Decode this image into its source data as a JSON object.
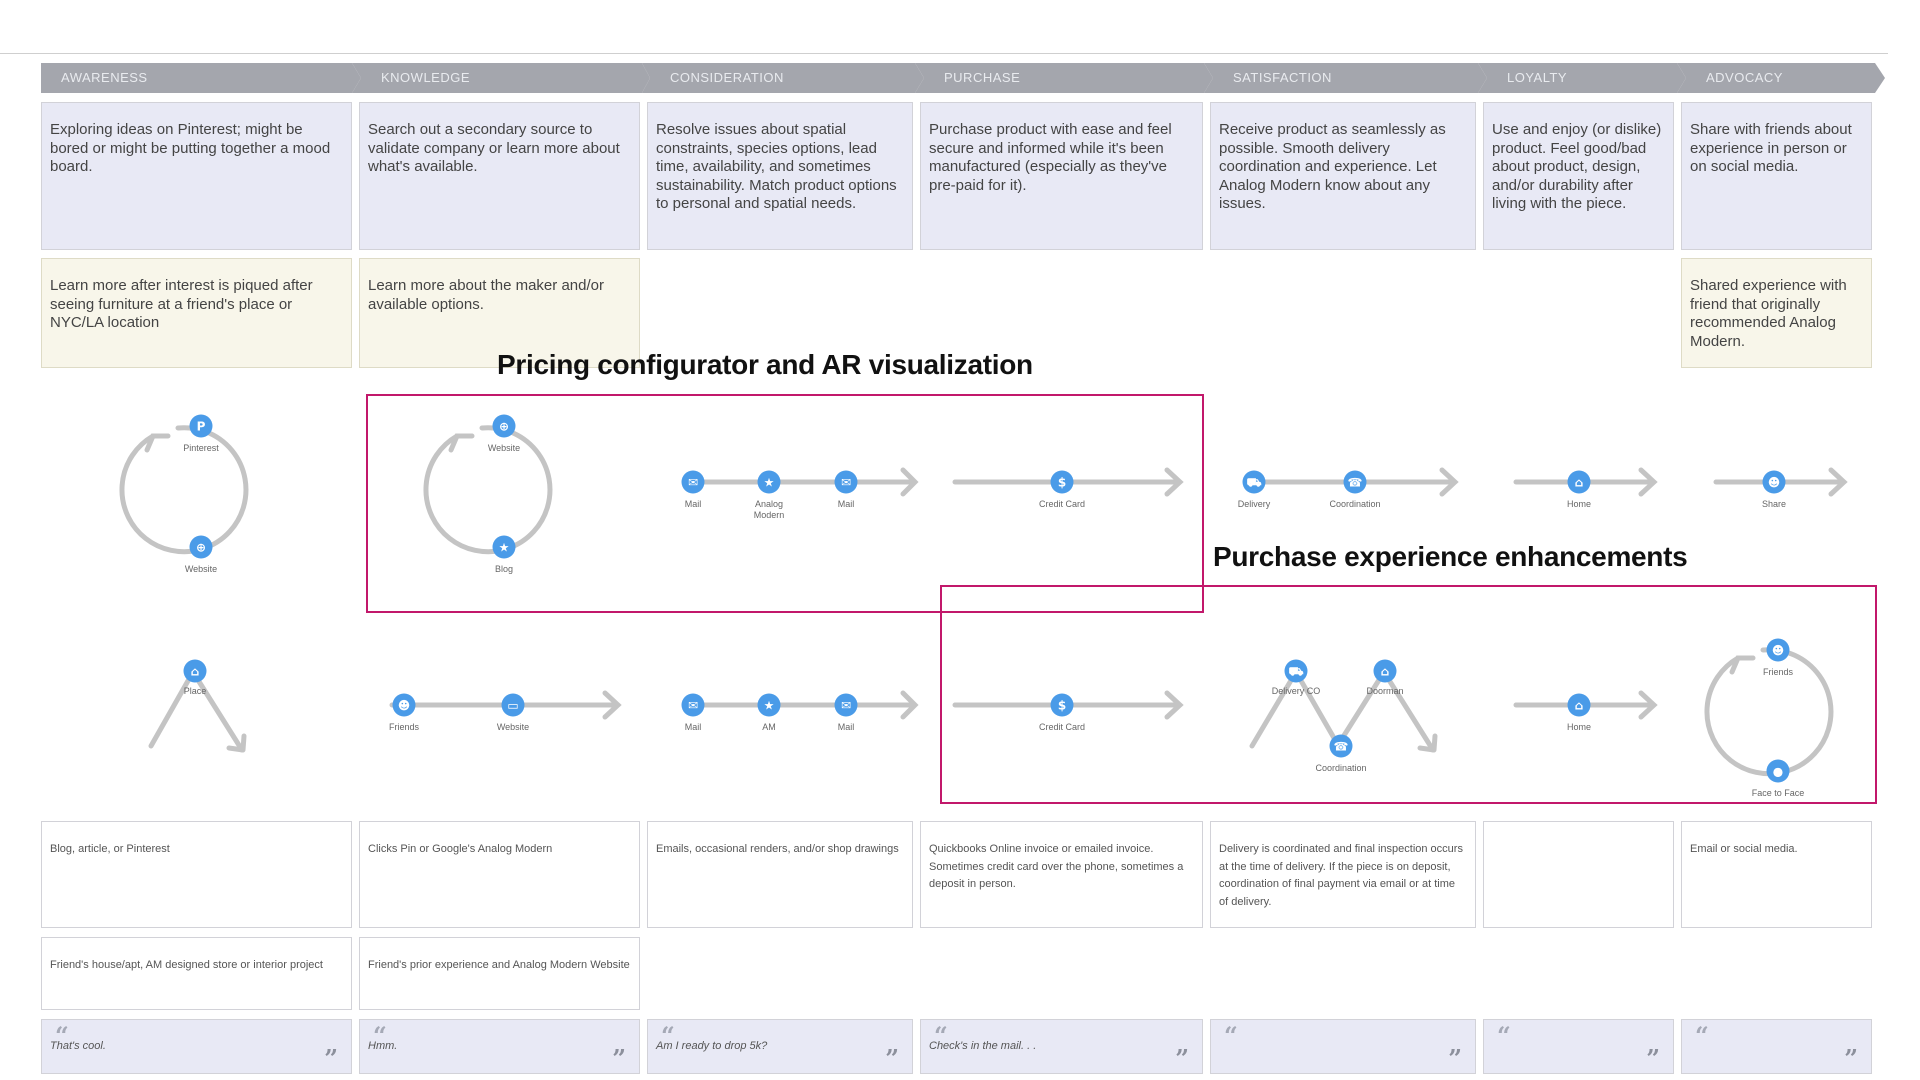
{
  "stages": [
    {
      "label": "AWARENESS"
    },
    {
      "label": "KNOWLEDGE"
    },
    {
      "label": "CONSIDERATION"
    },
    {
      "label": "PURCHASE"
    },
    {
      "label": "SATISFACTION"
    },
    {
      "label": "LOYALTY"
    },
    {
      "label": "ADVOCACY"
    }
  ],
  "goals": [
    "Exploring ideas on Pinterest; might be bored or might be putting together a mood board.",
    "Search out a secondary source to validate company or learn more about what's available.",
    "Resolve issues about spatial constraints, species options, lead time, availability, and sometimes sustainability.  Match product options to personal and spatial needs.",
    "Purchase product with ease and feel secure and informed while it's been manufactured (especially as they've pre-paid for it).",
    "Receive product as seamlessly as possible.  Smooth delivery coordination and experience.  Let Analog Modern know about any issues.",
    "Use and enjoy (or dislike) product.  Feel good/bad about product, design, and/or durability after living with the piece.",
    "Share with friends about experience in person or on social media."
  ],
  "alt_goals": {
    "awareness": "Learn more after interest is piqued after seeing furniture at a friend's place or NYC/LA location",
    "knowledge": "Learn more about the maker and/or available options.",
    "advocacy": "Shared experience with friend that originally recommended Analog Modern."
  },
  "callouts": {
    "pricing": "Pricing configurator and AR visualization",
    "purchase": "Purchase experience enhancements"
  },
  "touchpoints_row1": {
    "awareness": [
      "Pinterest",
      "Website"
    ],
    "knowledge": [
      "Website",
      "Blog"
    ],
    "consideration": [
      "Mail",
      "Analog Modern",
      "Mail"
    ],
    "purchase": [
      "Credit Card"
    ],
    "satisfaction": [
      "Delivery",
      "Coordination"
    ],
    "loyalty": [
      "Home"
    ],
    "advocacy": [
      "Share"
    ]
  },
  "touchpoints_row2": {
    "awareness": [
      "Place"
    ],
    "knowledge": [
      "Friends",
      "Website"
    ],
    "consideration": [
      "Mail",
      "AM",
      "Mail"
    ],
    "purchase": [
      "Credit Card"
    ],
    "satisfaction": [
      "Delivery CO",
      "Doorman",
      "Coordination"
    ],
    "loyalty": [
      "Home"
    ],
    "advocacy": [
      "Friends",
      "Face to Face"
    ]
  },
  "channels": [
    "Blog, article, or Pinterest",
    "Clicks Pin or Google's Analog Modern",
    "Emails, occasional renders, and/or shop drawings",
    "Quickbooks Online invoice or emailed invoice.  Sometimes credit card over the phone, sometimes a deposit in person.",
    "Delivery is coordinated and final inspection occurs at the time of delivery.  If the piece is on deposit, coordination of final payment via email or at time of delivery.",
    "",
    "Email or social media."
  ],
  "alt_channels": {
    "awareness": "Friend's house/apt, AM designed store or interior project",
    "knowledge": "Friend's prior experience and Analog Modern Website"
  },
  "quotes": [
    "That's cool.",
    "Hmm.",
    "Am I ready to drop 5k?",
    "Check's in the mail. . .",
    "",
    "",
    ""
  ],
  "colors": {
    "stage_bar": "#a4a6ad",
    "goal_card": "#e8e9f5",
    "alt_card": "#f8f6ea",
    "icon_blue": "#4a9be8",
    "flow_gray": "#c4c4c4",
    "callout_border": "#c2186b"
  }
}
